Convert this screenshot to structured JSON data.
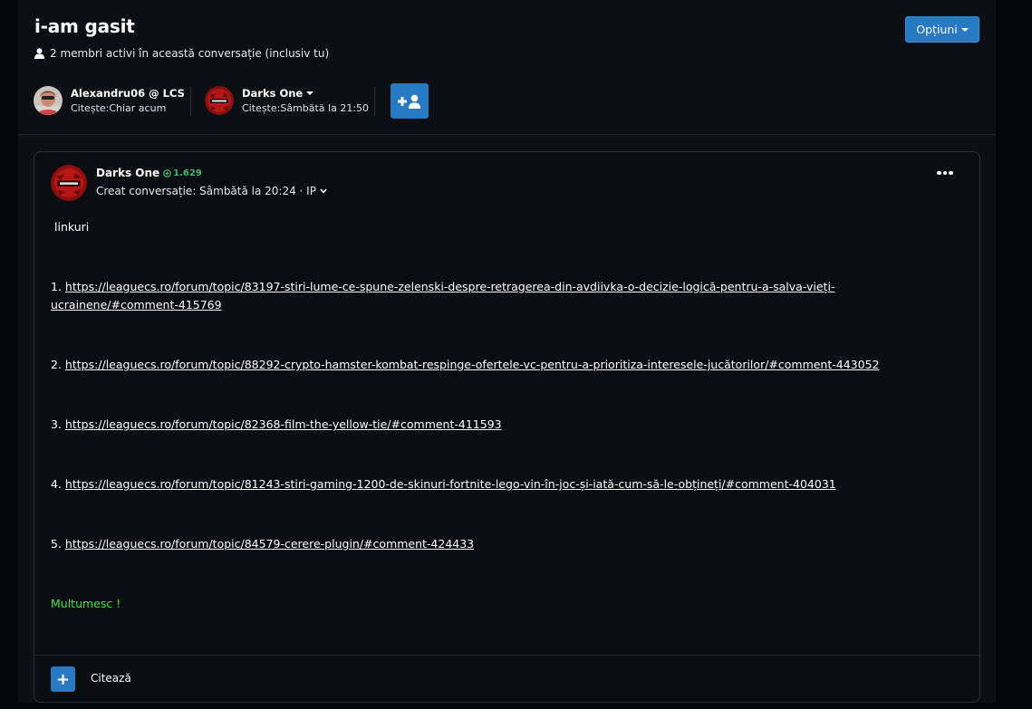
{
  "conversation": {
    "title": "i-am gasit",
    "active_members": "2 membri activi în această conversație (inclusiv tu)",
    "options_label": "Opțiuni"
  },
  "participants": [
    {
      "name": "Alexandru06 @ LCS",
      "status": "Citește:Chiar acum"
    },
    {
      "name": "Darks One",
      "status": "Citește:Sâmbătă la 21:50"
    }
  ],
  "post": {
    "author": "Darks One",
    "reputation": "1.629",
    "meta": "Creat conversație: Sâmbătă la 20:24 · IP",
    "intro": "linkuri",
    "links": [
      {
        "number": "1.",
        "url": "https://leaguecs.ro/forum/topic/83197-stiri-lume-ce-spune-zelenski-despre-retragerea-din-avdiivka-o-decizie-logică-pentru-a-salva-vieți-ucrainene/#comment-415769"
      },
      {
        "number": "2.",
        "url": "https://leaguecs.ro/forum/topic/88292-crypto-hamster-kombat-respinge-ofertele-vc-pentru-a-prioritiza-interesele-jucătorilor/#comment-443052"
      },
      {
        "number": "3.",
        "url": "https://leaguecs.ro/forum/topic/82368-film-the-yellow-tie/#comment-411593"
      },
      {
        "number": "4.",
        "url": "https://leaguecs.ro/forum/topic/81243-stiri-gaming-1200-de-skinuri-fortnite-lego-vin-în-joc-și-iată-cum-să-le-obțineți/#comment-404031"
      },
      {
        "number": "5.",
        "url": "https://leaguecs.ro/forum/topic/84579-cerere-plugin/#comment-424433"
      }
    ],
    "thanks": "Multumesc !",
    "quote_label": "Citează"
  },
  "colors": {
    "accent": "#2679c2",
    "reputation": "#3fb96b",
    "thanks": "#3ee63e"
  }
}
